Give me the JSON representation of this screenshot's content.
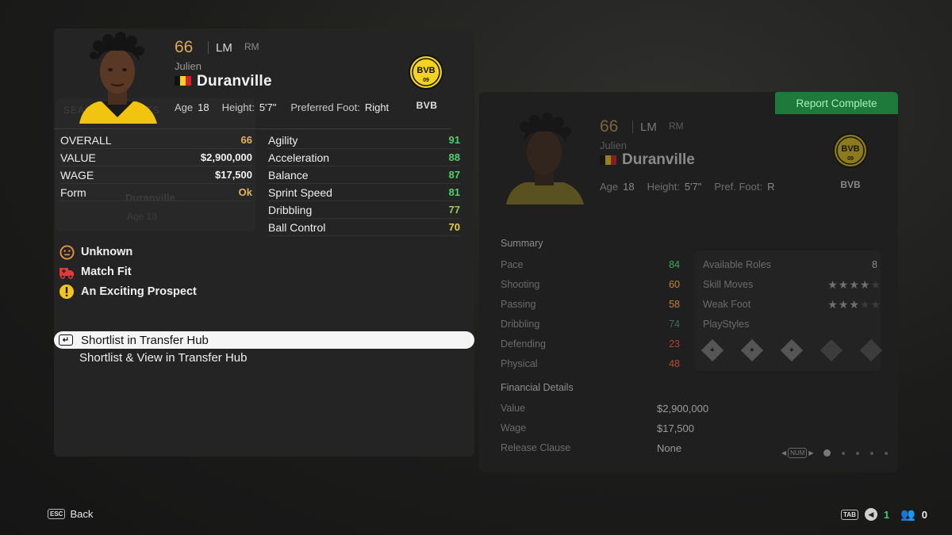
{
  "left_card": {
    "ghost": {
      "title": "SEARCH RESULTS",
      "name": "Duranville",
      "meta": "Age 18"
    },
    "player": {
      "rating": "66",
      "position": "LM",
      "alt_position": "RM",
      "first_name": "Julien",
      "last_name": "Duranville",
      "nationality_colors": [
        "#111111",
        "#f4d31c",
        "#d8202a"
      ],
      "age_label": "Age",
      "age": "18",
      "height_label": "Height:",
      "height": "5'7\"",
      "foot_label": "Preferred Foot:",
      "foot": "Right",
      "club_abbr": "BVB",
      "club_badge_text": "BVB",
      "club_badge_sub": "09"
    },
    "left_stats": [
      {
        "label": "OVERALL",
        "value": "66",
        "color": "#e3b35d"
      },
      {
        "label": "VALUE",
        "value": "$2,900,000",
        "color": "#f2f2f2"
      },
      {
        "label": "WAGE",
        "value": "$17,500",
        "color": "#f2f2f2"
      },
      {
        "label": "Form",
        "value": "Ok",
        "color": "#e3b35d"
      }
    ],
    "right_stats": [
      {
        "label": "Agility",
        "value": "91",
        "color": "#4fd06a"
      },
      {
        "label": "Acceleration",
        "value": "88",
        "color": "#4fd06a"
      },
      {
        "label": "Balance",
        "value": "87",
        "color": "#4fd06a"
      },
      {
        "label": "Sprint Speed",
        "value": "81",
        "color": "#4fd06a"
      },
      {
        "label": "Dribbling",
        "value": "77",
        "color": "#8fcf4f"
      },
      {
        "label": "Ball Control",
        "value": "70",
        "color": "#e3d04f"
      }
    ],
    "statuses": [
      {
        "icon": "neutral-face-icon",
        "label": "Unknown",
        "color": "#e5943a"
      },
      {
        "icon": "ambulance-icon",
        "label": "Match Fit",
        "color": "#e23a3a"
      },
      {
        "icon": "warning-icon",
        "label": "An Exciting Prospect",
        "color": "#f5c518"
      }
    ],
    "actions": [
      {
        "label": "Shortlist in Transfer Hub",
        "selected": true,
        "key": "↵"
      },
      {
        "label": "Shortlist & View in Transfer Hub",
        "selected": false
      }
    ]
  },
  "report": {
    "status_button": "Report Complete",
    "player": {
      "rating": "66",
      "position": "LM",
      "alt_position": "RM",
      "first_name": "Julien",
      "last_name": "Duranville",
      "age_label": "Age",
      "age": "18",
      "height_label": "Height:",
      "height": "5'7\"",
      "foot_label": "Pref. Foot:",
      "foot": "R",
      "club_abbr": "BVB"
    },
    "summary_title": "Summary",
    "summary": [
      {
        "label": "Pace",
        "value": "84",
        "color": "#3ea85a"
      },
      {
        "label": "Shooting",
        "value": "60",
        "color": "#c4843a"
      },
      {
        "label": "Passing",
        "value": "58",
        "color": "#c4843a"
      },
      {
        "label": "Dribbling",
        "value": "74",
        "color": "#3a6e55"
      },
      {
        "label": "Defending",
        "value": "23",
        "color": "#b0402f"
      },
      {
        "label": "Physical",
        "value": "48",
        "color": "#b0502f"
      }
    ],
    "extras": {
      "available_roles_label": "Available Roles",
      "available_roles": "8",
      "skill_moves_label": "Skill Moves",
      "skill_moves": 4,
      "weak_foot_label": "Weak Foot",
      "weak_foot": 3,
      "playstyles_label": "PlayStyles",
      "playstyles": [
        "playstyle-1-icon",
        "playstyle-2-icon",
        "playstyle-3-icon",
        "playstyle-4-icon",
        "playstyle-5-icon"
      ]
    },
    "financial_title": "Financial Details",
    "financial": [
      {
        "label": "Value",
        "value": "$2,900,000"
      },
      {
        "label": "Wage",
        "value": "$17,500"
      },
      {
        "label": "Release Clause",
        "value": "None"
      }
    ],
    "pager": {
      "key": "NUM",
      "pages": 5,
      "active": 1
    }
  },
  "footer": {
    "back_key": "ESC",
    "back_label": "Back",
    "tab_key": "TAB",
    "notifications": "1",
    "friends": "0"
  }
}
